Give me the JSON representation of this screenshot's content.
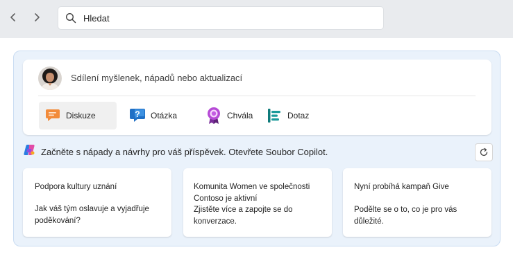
{
  "nav": {
    "back_icon": "chevron-left-icon",
    "forward_icon": "chevron-right-icon"
  },
  "search": {
    "placeholder": "Hledat",
    "icon": "search-icon"
  },
  "composer": {
    "prompt": "Sdílení myšlenek, nápadů nebo aktualizací",
    "post_types": [
      {
        "label": "Diskuze",
        "icon": "discussion-icon",
        "color": "#e8823a",
        "selected": true
      },
      {
        "label": "Otázka",
        "icon": "question-icon",
        "color": "#1b6ec2"
      },
      {
        "label": "Chvála",
        "icon": "praise-icon",
        "color": "#9b3fb5"
      },
      {
        "label": "Dotaz",
        "icon": "poll-icon",
        "color": "#148c8c"
      }
    ]
  },
  "copilot": {
    "text": "Začněte s nápady a návrhy pro váš příspěvek. Otevřete Soubor Copilot.",
    "icon": "copilot-icon",
    "refresh_icon": "refresh-icon"
  },
  "suggestions": [
    {
      "title": "Podpora kultury uznání",
      "description": "Jak váš tým oslavuje a vyjadřuje poděkování?"
    },
    {
      "title": "Komunita Women ve společnosti Contoso je aktivní",
      "description": "Zjistěte více a zapojte se do konverzace."
    },
    {
      "title": "Nyní probíhá kampaň Give",
      "description": "Podělte se o to, co je pro vás důležité."
    }
  ],
  "colors": {
    "topbar": "#e9ebee",
    "panel": "#eaf2fb",
    "panel_border": "#c9dcf2"
  }
}
